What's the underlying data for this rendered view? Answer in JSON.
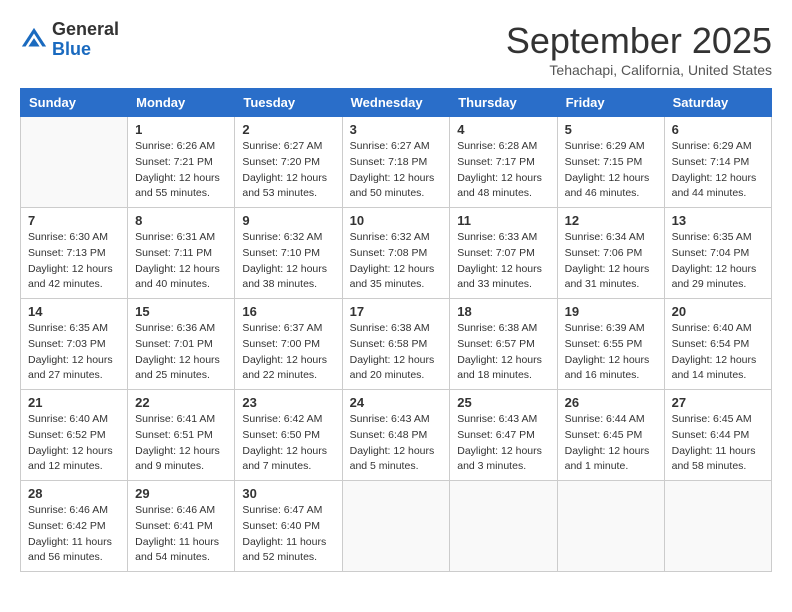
{
  "logo": {
    "general": "General",
    "blue": "Blue"
  },
  "header": {
    "month": "September 2025",
    "location": "Tehachapi, California, United States"
  },
  "weekdays": [
    "Sunday",
    "Monday",
    "Tuesday",
    "Wednesday",
    "Thursday",
    "Friday",
    "Saturday"
  ],
  "weeks": [
    [
      {
        "day": "",
        "sunrise": "",
        "sunset": "",
        "daylight": ""
      },
      {
        "day": "1",
        "sunrise": "Sunrise: 6:26 AM",
        "sunset": "Sunset: 7:21 PM",
        "daylight": "Daylight: 12 hours and 55 minutes."
      },
      {
        "day": "2",
        "sunrise": "Sunrise: 6:27 AM",
        "sunset": "Sunset: 7:20 PM",
        "daylight": "Daylight: 12 hours and 53 minutes."
      },
      {
        "day": "3",
        "sunrise": "Sunrise: 6:27 AM",
        "sunset": "Sunset: 7:18 PM",
        "daylight": "Daylight: 12 hours and 50 minutes."
      },
      {
        "day": "4",
        "sunrise": "Sunrise: 6:28 AM",
        "sunset": "Sunset: 7:17 PM",
        "daylight": "Daylight: 12 hours and 48 minutes."
      },
      {
        "day": "5",
        "sunrise": "Sunrise: 6:29 AM",
        "sunset": "Sunset: 7:15 PM",
        "daylight": "Daylight: 12 hours and 46 minutes."
      },
      {
        "day": "6",
        "sunrise": "Sunrise: 6:29 AM",
        "sunset": "Sunset: 7:14 PM",
        "daylight": "Daylight: 12 hours and 44 minutes."
      }
    ],
    [
      {
        "day": "7",
        "sunrise": "Sunrise: 6:30 AM",
        "sunset": "Sunset: 7:13 PM",
        "daylight": "Daylight: 12 hours and 42 minutes."
      },
      {
        "day": "8",
        "sunrise": "Sunrise: 6:31 AM",
        "sunset": "Sunset: 7:11 PM",
        "daylight": "Daylight: 12 hours and 40 minutes."
      },
      {
        "day": "9",
        "sunrise": "Sunrise: 6:32 AM",
        "sunset": "Sunset: 7:10 PM",
        "daylight": "Daylight: 12 hours and 38 minutes."
      },
      {
        "day": "10",
        "sunrise": "Sunrise: 6:32 AM",
        "sunset": "Sunset: 7:08 PM",
        "daylight": "Daylight: 12 hours and 35 minutes."
      },
      {
        "day": "11",
        "sunrise": "Sunrise: 6:33 AM",
        "sunset": "Sunset: 7:07 PM",
        "daylight": "Daylight: 12 hours and 33 minutes."
      },
      {
        "day": "12",
        "sunrise": "Sunrise: 6:34 AM",
        "sunset": "Sunset: 7:06 PM",
        "daylight": "Daylight: 12 hours and 31 minutes."
      },
      {
        "day": "13",
        "sunrise": "Sunrise: 6:35 AM",
        "sunset": "Sunset: 7:04 PM",
        "daylight": "Daylight: 12 hours and 29 minutes."
      }
    ],
    [
      {
        "day": "14",
        "sunrise": "Sunrise: 6:35 AM",
        "sunset": "Sunset: 7:03 PM",
        "daylight": "Daylight: 12 hours and 27 minutes."
      },
      {
        "day": "15",
        "sunrise": "Sunrise: 6:36 AM",
        "sunset": "Sunset: 7:01 PM",
        "daylight": "Daylight: 12 hours and 25 minutes."
      },
      {
        "day": "16",
        "sunrise": "Sunrise: 6:37 AM",
        "sunset": "Sunset: 7:00 PM",
        "daylight": "Daylight: 12 hours and 22 minutes."
      },
      {
        "day": "17",
        "sunrise": "Sunrise: 6:38 AM",
        "sunset": "Sunset: 6:58 PM",
        "daylight": "Daylight: 12 hours and 20 minutes."
      },
      {
        "day": "18",
        "sunrise": "Sunrise: 6:38 AM",
        "sunset": "Sunset: 6:57 PM",
        "daylight": "Daylight: 12 hours and 18 minutes."
      },
      {
        "day": "19",
        "sunrise": "Sunrise: 6:39 AM",
        "sunset": "Sunset: 6:55 PM",
        "daylight": "Daylight: 12 hours and 16 minutes."
      },
      {
        "day": "20",
        "sunrise": "Sunrise: 6:40 AM",
        "sunset": "Sunset: 6:54 PM",
        "daylight": "Daylight: 12 hours and 14 minutes."
      }
    ],
    [
      {
        "day": "21",
        "sunrise": "Sunrise: 6:40 AM",
        "sunset": "Sunset: 6:52 PM",
        "daylight": "Daylight: 12 hours and 12 minutes."
      },
      {
        "day": "22",
        "sunrise": "Sunrise: 6:41 AM",
        "sunset": "Sunset: 6:51 PM",
        "daylight": "Daylight: 12 hours and 9 minutes."
      },
      {
        "day": "23",
        "sunrise": "Sunrise: 6:42 AM",
        "sunset": "Sunset: 6:50 PM",
        "daylight": "Daylight: 12 hours and 7 minutes."
      },
      {
        "day": "24",
        "sunrise": "Sunrise: 6:43 AM",
        "sunset": "Sunset: 6:48 PM",
        "daylight": "Daylight: 12 hours and 5 minutes."
      },
      {
        "day": "25",
        "sunrise": "Sunrise: 6:43 AM",
        "sunset": "Sunset: 6:47 PM",
        "daylight": "Daylight: 12 hours and 3 minutes."
      },
      {
        "day": "26",
        "sunrise": "Sunrise: 6:44 AM",
        "sunset": "Sunset: 6:45 PM",
        "daylight": "Daylight: 12 hours and 1 minute."
      },
      {
        "day": "27",
        "sunrise": "Sunrise: 6:45 AM",
        "sunset": "Sunset: 6:44 PM",
        "daylight": "Daylight: 11 hours and 58 minutes."
      }
    ],
    [
      {
        "day": "28",
        "sunrise": "Sunrise: 6:46 AM",
        "sunset": "Sunset: 6:42 PM",
        "daylight": "Daylight: 11 hours and 56 minutes."
      },
      {
        "day": "29",
        "sunrise": "Sunrise: 6:46 AM",
        "sunset": "Sunset: 6:41 PM",
        "daylight": "Daylight: 11 hours and 54 minutes."
      },
      {
        "day": "30",
        "sunrise": "Sunrise: 6:47 AM",
        "sunset": "Sunset: 6:40 PM",
        "daylight": "Daylight: 11 hours and 52 minutes."
      },
      {
        "day": "",
        "sunrise": "",
        "sunset": "",
        "daylight": ""
      },
      {
        "day": "",
        "sunrise": "",
        "sunset": "",
        "daylight": ""
      },
      {
        "day": "",
        "sunrise": "",
        "sunset": "",
        "daylight": ""
      },
      {
        "day": "",
        "sunrise": "",
        "sunset": "",
        "daylight": ""
      }
    ]
  ]
}
